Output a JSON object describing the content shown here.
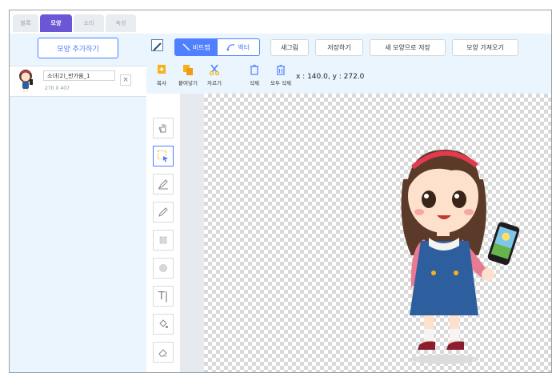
{
  "tabs": [
    {
      "label": "블록"
    },
    {
      "label": "모양"
    },
    {
      "label": "소리"
    },
    {
      "label": "속성"
    }
  ],
  "left_panel": {
    "add_button": "모양 추가하기",
    "shape": {
      "name": "소녀(2)_반가움_1",
      "size": "270 X 407",
      "delete": "×"
    }
  },
  "toolbar": {
    "bitmap": "비트맵",
    "vector": "벡터",
    "new": "새그림",
    "save": "저장하기",
    "save_new": "새 모양으로 저장",
    "import": "모양 가져오기"
  },
  "actions": [
    {
      "label": "복사",
      "icon": "copy-icon"
    },
    {
      "label": "붙여넣기",
      "icon": "paste-icon"
    },
    {
      "label": "자르기",
      "icon": "cut-icon"
    },
    {
      "label": "삭제",
      "icon": "trash-icon"
    },
    {
      "label": "모두 삭제",
      "icon": "trash-all-icon"
    }
  ],
  "coords": "x : 140.0, y : 272.0",
  "tools": [
    {
      "name": "hand-tool",
      "icon": "hand-icon"
    },
    {
      "name": "select-tool",
      "icon": "select-icon",
      "selected": true
    },
    {
      "name": "pen-tool",
      "icon": "pen-icon"
    },
    {
      "name": "pencil-tool",
      "icon": "pencil-icon"
    },
    {
      "name": "rect-tool",
      "icon": "rect-icon"
    },
    {
      "name": "ellipse-tool",
      "icon": "ellipse-icon"
    },
    {
      "name": "text-tool",
      "icon": "text-icon",
      "glyph": "T|"
    },
    {
      "name": "fill-tool",
      "icon": "fill-icon"
    },
    {
      "name": "eraser-tool",
      "icon": "eraser-icon"
    }
  ],
  "colors": {
    "accent": "#4f80ff",
    "tab_active": "#6b57d6",
    "panel_bg": "#eaf5fd"
  }
}
